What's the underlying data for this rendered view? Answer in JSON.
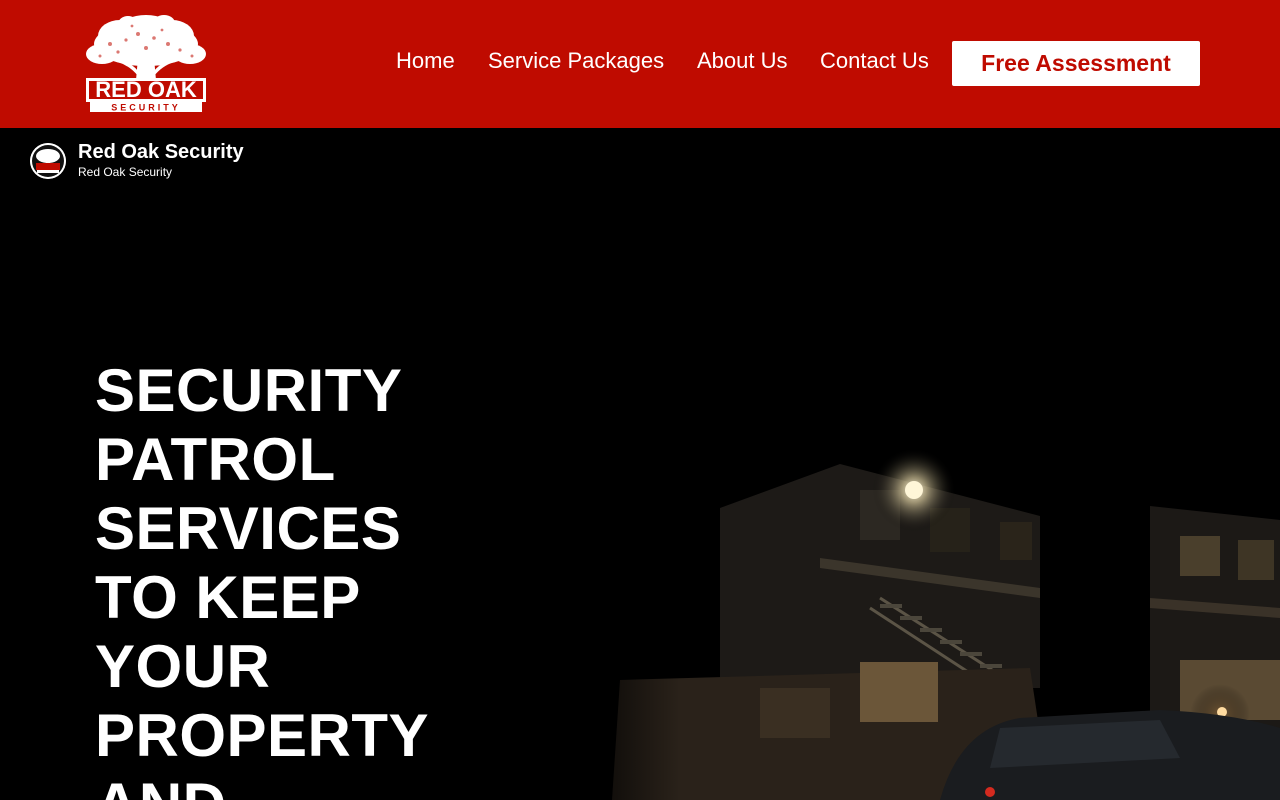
{
  "brand": {
    "logo_text_top": "RED OAK",
    "logo_text_bottom": "SECURITY"
  },
  "nav": {
    "items": [
      {
        "label": "Home"
      },
      {
        "label": "Service Packages"
      },
      {
        "label": "About Us"
      },
      {
        "label": "Contact Us"
      }
    ],
    "cta_label": "Free Assessment"
  },
  "video": {
    "channel_title": "Red Oak Security",
    "channel_subtitle": "Red Oak Security"
  },
  "hero": {
    "headline_lines": [
      "SECURITY",
      "PATROL",
      "SERVICES",
      "TO KEEP",
      "YOUR",
      "PROPERTY",
      "AND"
    ]
  },
  "colors": {
    "brand_red": "#bf0b00",
    "background": "#000000",
    "text": "#ffffff"
  }
}
